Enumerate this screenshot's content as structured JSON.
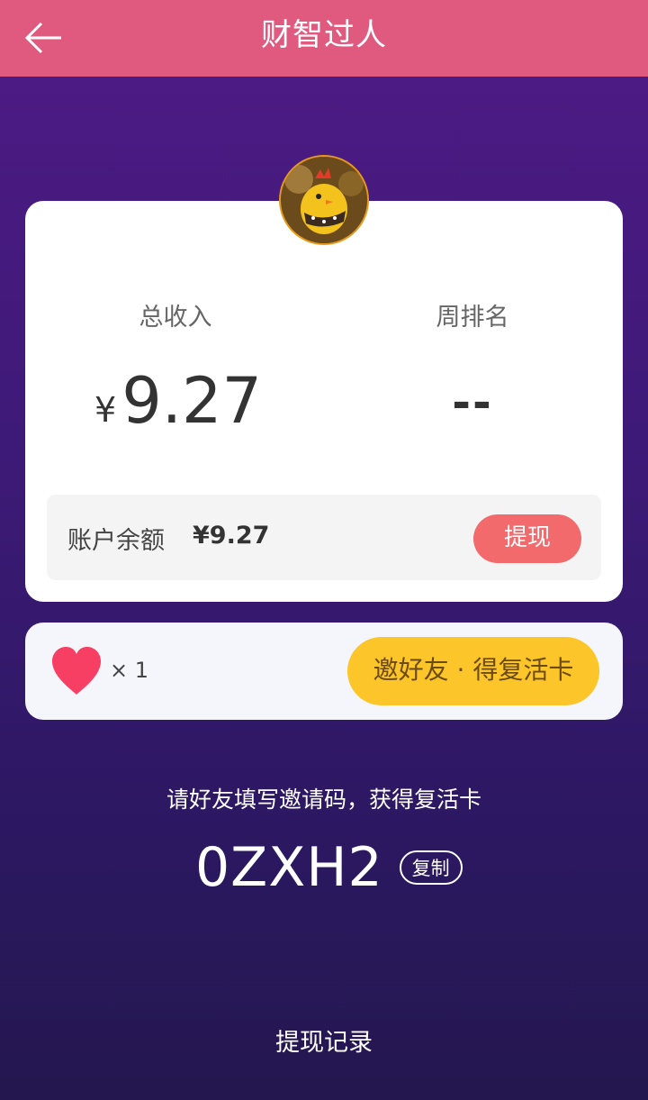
{
  "header": {
    "title": "财智过人",
    "back_icon": "arrow-left-icon"
  },
  "profile": {
    "avatar_icon": "chick-avatar"
  },
  "stats": {
    "income_label": "总收入",
    "income_currency": "¥",
    "income_value": "9.27",
    "rank_label": "周排名",
    "rank_value": "--"
  },
  "balance": {
    "label": "账户余额",
    "value": "¥9.27",
    "withdraw_label": "提现"
  },
  "revive": {
    "heart_icon": "heart-icon",
    "count": "× 1",
    "invite_label": "邀好友 · 得复活卡"
  },
  "invite": {
    "tip": "请好友填写邀请码，获得复活卡",
    "code": "0ZXH2",
    "copy_label": "复制"
  },
  "footer": {
    "history_label": "提现记录"
  },
  "colors": {
    "header": "#e05a80",
    "accent_red": "#f26a6c",
    "accent_yellow": "#fcc62a",
    "bg_top": "#4f1b86",
    "bg_bottom": "#24174f"
  }
}
